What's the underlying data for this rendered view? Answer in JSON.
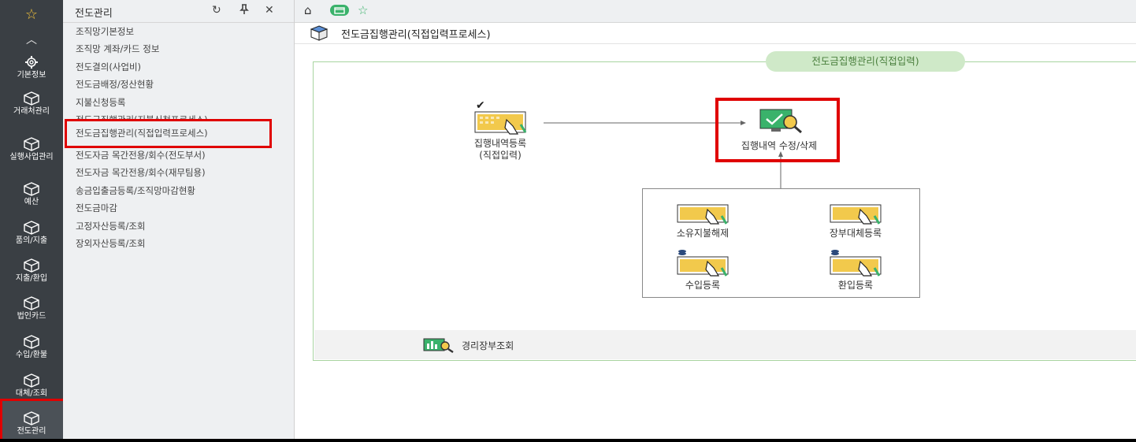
{
  "rail": {
    "items": [
      {
        "label": "기본정보",
        "icon": "gear-icon"
      },
      {
        "label": "거래처관리",
        "icon": "box-icon"
      },
      {
        "label": "실행사업관리",
        "icon": "box-icon"
      },
      {
        "label": "예산",
        "icon": "box-icon"
      },
      {
        "label": "품의/지출",
        "icon": "box-icon"
      },
      {
        "label": "지출/환입",
        "icon": "box-icon"
      },
      {
        "label": "법인카드",
        "icon": "box-icon"
      },
      {
        "label": "수입/환불",
        "icon": "box-icon"
      },
      {
        "label": "대체/조회",
        "icon": "box-icon"
      },
      {
        "label": "전도관리",
        "icon": "box-icon"
      }
    ],
    "active_color": "#e00000"
  },
  "submenu": {
    "title": "전도관리",
    "items": [
      "조직망기본정보",
      "조직망 계좌/카드 정보",
      "전도결의(사업비)",
      "전도금배정/정산현황",
      "지불신청등록",
      "전도금집행관리(지불신청프로세스)",
      "전도금집행관리(직접입력프로세스)",
      "전도자금 목간전용/회수(전도부서)",
      "전도자금 목간전용/회수(재무팀용)",
      "송금입출금등록/조직망마감현황",
      "전도금마감",
      "고정자산등록/조회",
      "장외자산등록/조회"
    ]
  },
  "page": {
    "title": "전도금집행관리(직접입력프로세스)"
  },
  "flow": {
    "pill": "전도금집행관리(직접입력)",
    "node_register_l1": "집행내역등록",
    "node_register_l2": "(직접입력)",
    "node_edit": "집행내역 수정/삭제",
    "sub_nodes": [
      "소유지불해제",
      "장부대체등록",
      "수입등록",
      "환입등록"
    ],
    "footer": "경리장부조회"
  },
  "colors": {
    "rail_bg": "#3a3f44",
    "accent_green": "#cfe9c8",
    "highlight_red": "#e00000"
  }
}
